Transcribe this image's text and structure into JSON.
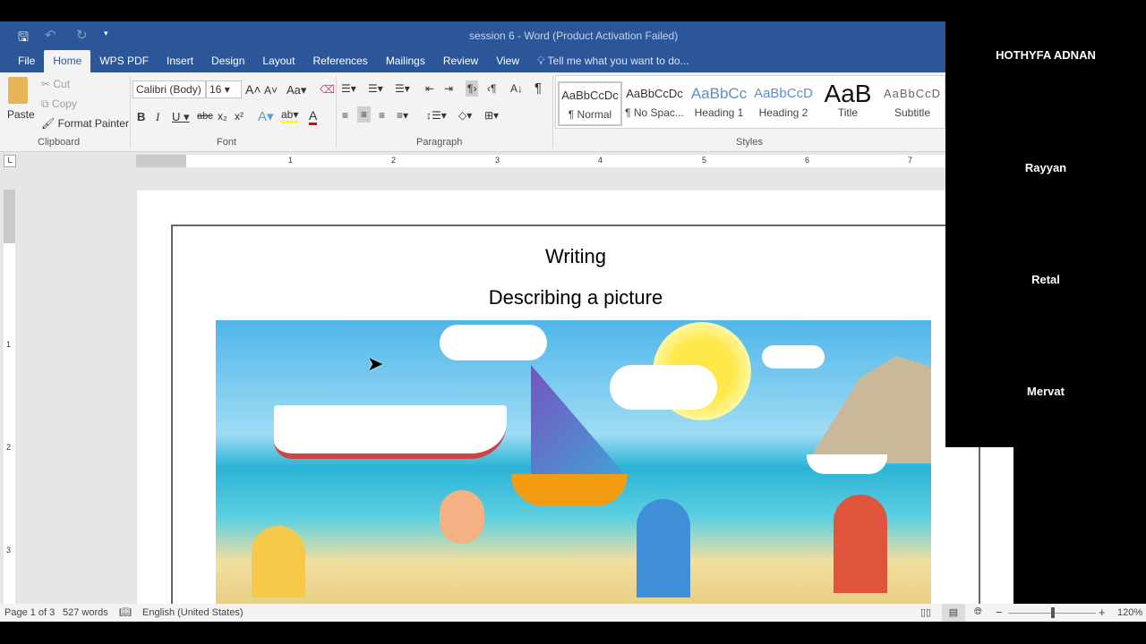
{
  "title": "session 6 - Word (Product Activation Failed)",
  "tabs": [
    "File",
    "Home",
    "WPS PDF",
    "Insert",
    "Design",
    "Layout",
    "References",
    "Mailings",
    "Review",
    "View"
  ],
  "tell_me": "Tell me what you want to do...",
  "clipboard": {
    "paste": "Paste",
    "cut": "Cut",
    "copy": "Copy",
    "format_painter": "Format Painter",
    "label": "Clipboard"
  },
  "font": {
    "name": "Calibri (Body)",
    "size": "16",
    "label": "Font",
    "case": "Aa"
  },
  "paragraph": {
    "label": "Paragraph"
  },
  "styles": {
    "label": "Styles",
    "items": [
      {
        "preview": "AaBbCcDc",
        "name": "¶ Normal"
      },
      {
        "preview": "AaBbCcDc",
        "name": "¶ No Spac..."
      },
      {
        "preview": "AaBbCc",
        "name": "Heading 1"
      },
      {
        "preview": "AaBbCcD",
        "name": "Heading 2"
      },
      {
        "preview": "AaB",
        "name": "Title"
      },
      {
        "preview": "AaBbCcD",
        "name": "Subtitle"
      }
    ]
  },
  "ruler": [
    "1",
    "2",
    "3",
    "4",
    "5",
    "6",
    "7"
  ],
  "vruler": [
    "1",
    "2",
    "3"
  ],
  "document": {
    "heading": "Writing",
    "subheading": "Describing a picture"
  },
  "status": {
    "page": "Page 1 of 3",
    "words": "527 words",
    "language": "English (United States)",
    "zoom": "120%",
    "zoom_fraction": 0.55
  },
  "participants": [
    "HOTHYFA ADNAN",
    "Rayyan",
    "Retal",
    "Mervat"
  ],
  "colors": {
    "accent": "#2b579a"
  }
}
